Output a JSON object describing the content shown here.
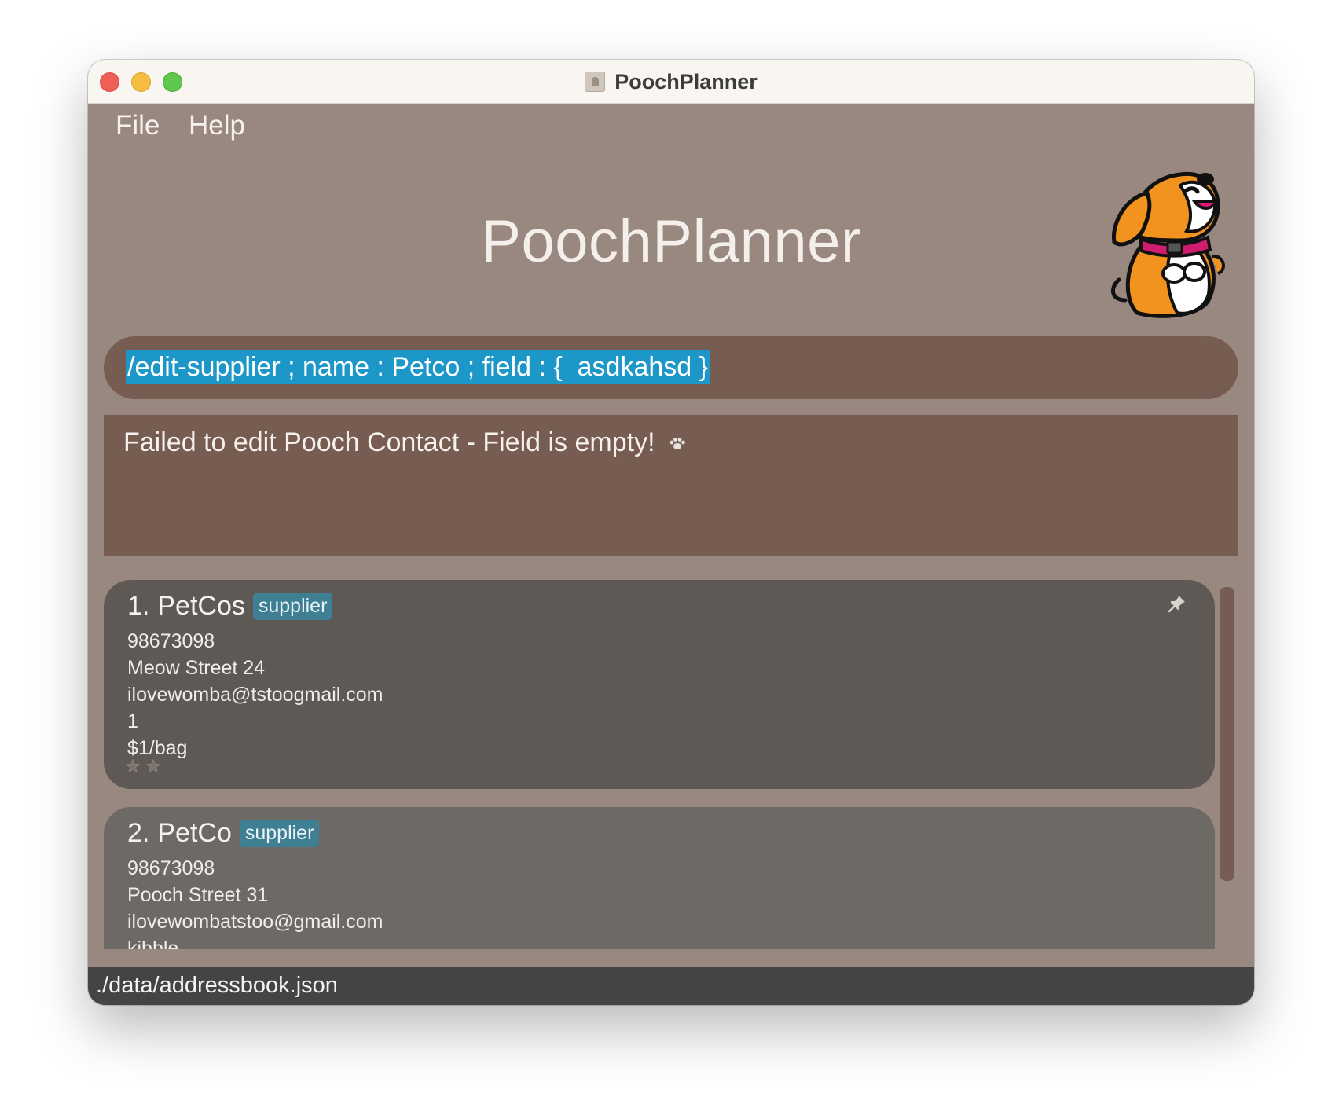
{
  "window": {
    "title": "PoochPlanner"
  },
  "menu": {
    "file": "File",
    "help": "Help"
  },
  "header": {
    "title": "PoochPlanner",
    "mascot_icon": "beagle-mascot-icon"
  },
  "command": {
    "value": "/edit-supplier ; name : Petco ; field : {  asdkahsd }"
  },
  "result": {
    "message": "Failed to edit Pooch Contact - Field is empty!",
    "icon": "paw-icon"
  },
  "contacts": [
    {
      "index": "1.",
      "name": "PetCos",
      "tag": "supplier",
      "phone": "98673098",
      "address": "Meow Street 24",
      "email": "ilovewomba@tstoogmail.com",
      "product": "1",
      "price": "$1/bag",
      "pinned": true,
      "rating": 2
    },
    {
      "index": "2.",
      "name": "PetCo",
      "tag": "supplier",
      "phone": "98673098",
      "address": "Pooch Street 31",
      "email": "ilovewombatstoo@gmail.com",
      "product": "kibble"
    }
  ],
  "status": {
    "path": "./data/addressbook.json"
  },
  "colors": {
    "background": "#998880",
    "panel": "#765c51",
    "card_selected": "#5f5955",
    "card": "#6d6965",
    "tag": "#3f7f94",
    "highlight": "#1d97c8",
    "statusbar": "#444444"
  }
}
